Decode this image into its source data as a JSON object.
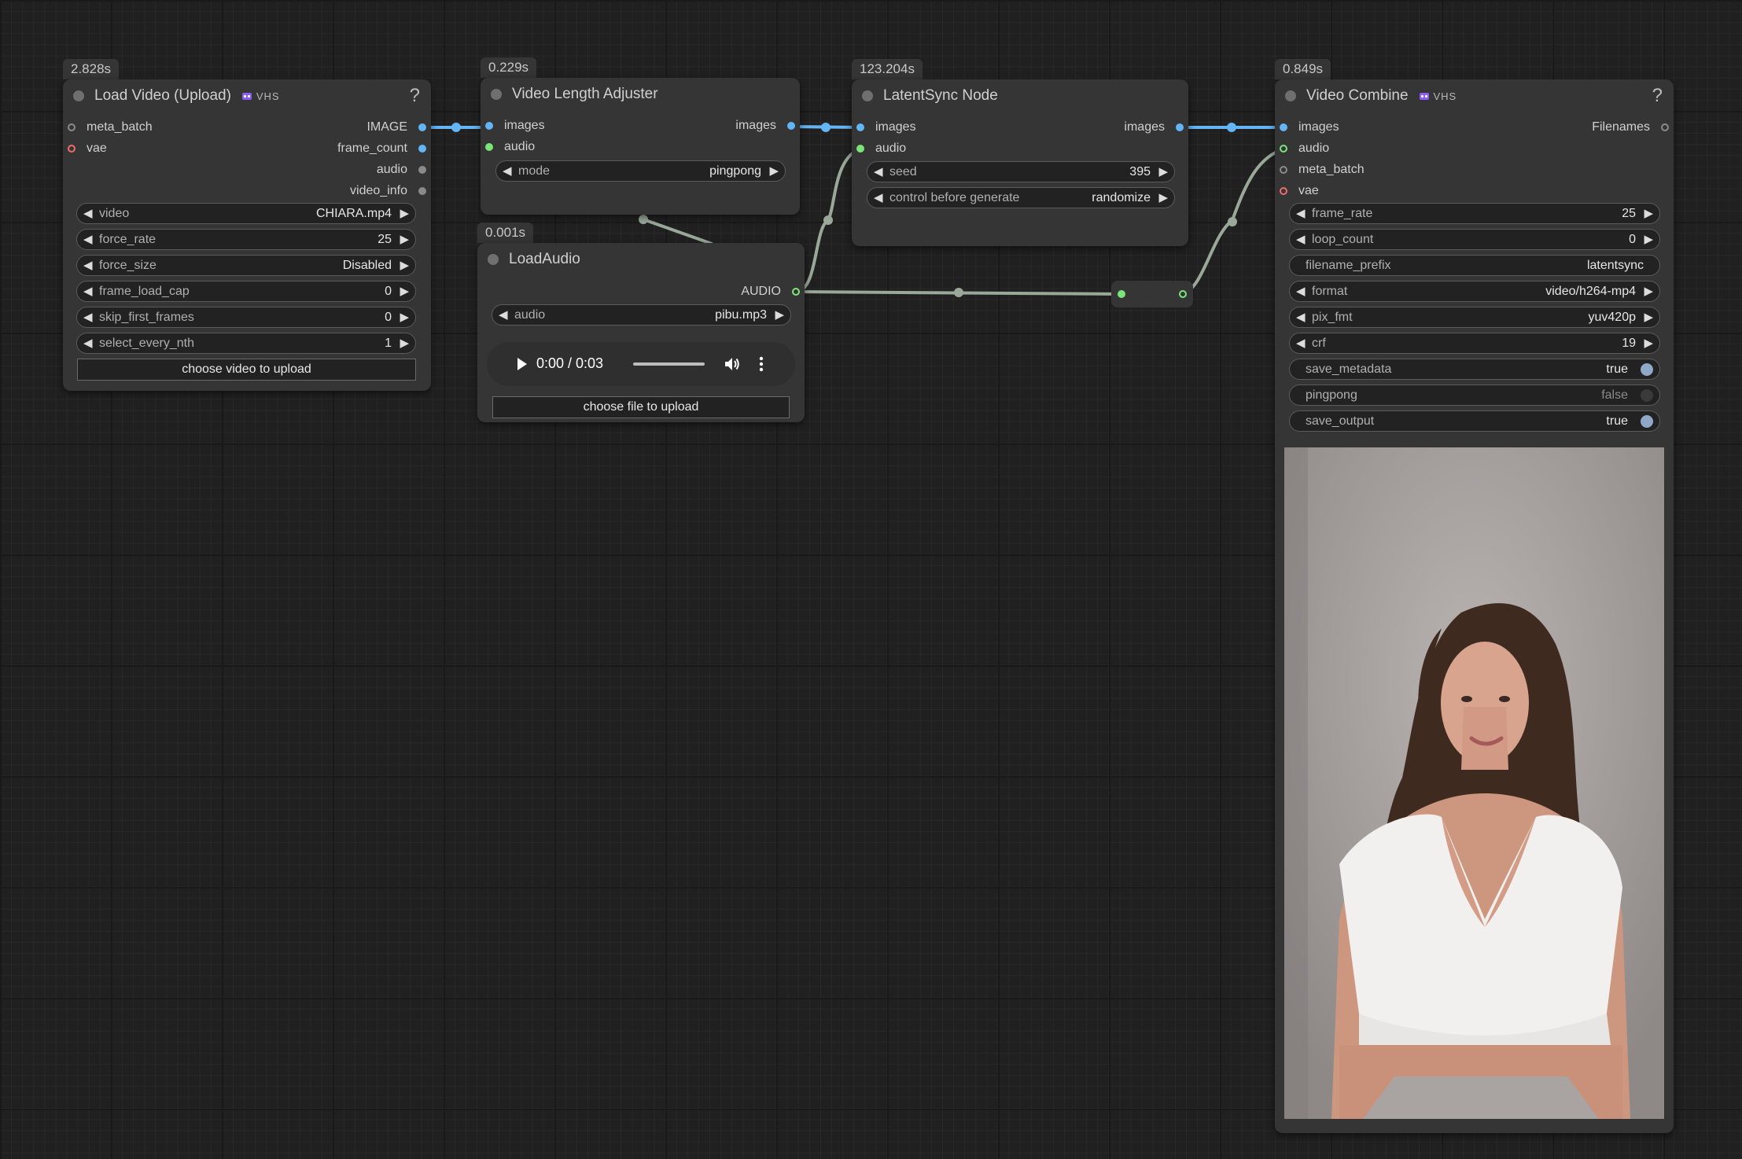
{
  "load_video": {
    "time": "2.828s",
    "title": "Load Video (Upload)",
    "tag": "VHS",
    "help": "?",
    "inputs": [
      "meta_batch",
      "vae"
    ],
    "outputs": [
      "IMAGE",
      "frame_count",
      "audio",
      "video_info"
    ],
    "widgets": [
      {
        "label": "video",
        "value": "CHIARA.mp4"
      },
      {
        "label": "force_rate",
        "value": "25"
      },
      {
        "label": "force_size",
        "value": "Disabled"
      },
      {
        "label": "frame_load_cap",
        "value": "0"
      },
      {
        "label": "skip_first_frames",
        "value": "0"
      },
      {
        "label": "select_every_nth",
        "value": "1"
      }
    ],
    "upload_button": "choose video to upload"
  },
  "video_length_adjuster": {
    "time": "0.229s",
    "title": "Video Length Adjuster",
    "inputs": [
      "images",
      "audio"
    ],
    "outputs": [
      "images"
    ],
    "widgets": [
      {
        "label": "mode",
        "value": "pingpong"
      }
    ]
  },
  "load_audio": {
    "time": "0.001s",
    "title": "LoadAudio",
    "outputs": [
      "AUDIO"
    ],
    "widgets": [
      {
        "label": "audio",
        "value": "pibu.mp3"
      }
    ],
    "player": {
      "time": "0:00 / 0:03"
    },
    "upload_button": "choose file to upload"
  },
  "latentsync": {
    "time": "123.204s",
    "title": "LatentSync Node",
    "inputs": [
      "images",
      "audio"
    ],
    "outputs": [
      "images"
    ],
    "widgets": [
      {
        "label": "seed",
        "value": "395"
      },
      {
        "label": "control before generate",
        "value": "randomize"
      }
    ]
  },
  "video_combine": {
    "time": "0.849s",
    "title": "Video Combine",
    "tag": "VHS",
    "help": "?",
    "inputs": [
      "images",
      "audio",
      "meta_batch",
      "vae"
    ],
    "outputs": [
      "Filenames"
    ],
    "widgets": [
      {
        "label": "frame_rate",
        "value": "25"
      },
      {
        "label": "loop_count",
        "value": "0"
      },
      {
        "label": "filename_prefix",
        "value": "latentsync"
      },
      {
        "label": "format",
        "value": "video/h264-mp4"
      },
      {
        "label": "pix_fmt",
        "value": "yuv420p"
      },
      {
        "label": "crf",
        "value": "19"
      },
      {
        "label": "save_metadata",
        "value": "true"
      },
      {
        "label": "pingpong",
        "value": "false"
      },
      {
        "label": "save_output",
        "value": "true"
      }
    ]
  },
  "colors": {
    "image_link": "#64b5f6",
    "audio_link": "#7ae67a",
    "node_bg": "#353535",
    "canvas_bg": "#202020"
  }
}
